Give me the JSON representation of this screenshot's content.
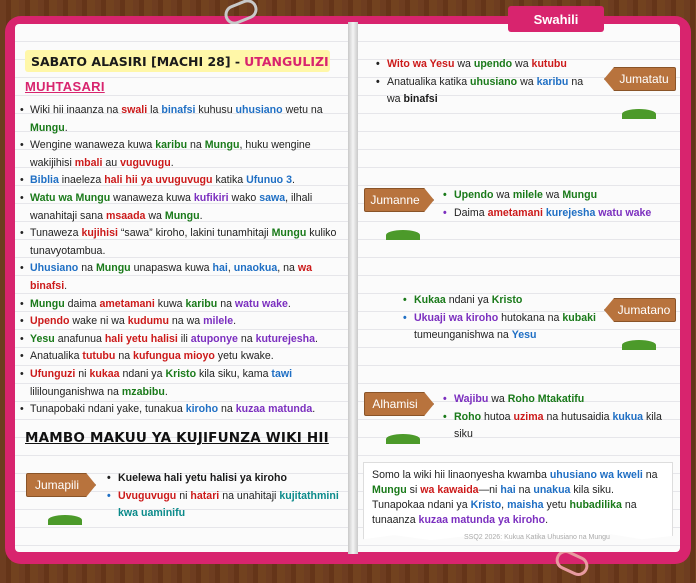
{
  "language_tab": "Swahili",
  "lesson": {
    "title": "SABATO ALASIRI [MACHI 28] -",
    "title_highlight": "UTANGULIZI"
  },
  "summary_heading": "MUHTASARI",
  "summary_points": [
    [
      [
        "Wiki hii inaanza na ",
        ""
      ],
      [
        "swali",
        "r"
      ],
      [
        " la ",
        ""
      ],
      [
        "binafsi",
        "b"
      ],
      [
        " kuhusu ",
        ""
      ],
      [
        "uhusiano",
        "b"
      ],
      [
        " wetu na ",
        ""
      ],
      [
        "Mungu",
        "g"
      ],
      [
        ".",
        ""
      ]
    ],
    [
      [
        "Wengine wanaweza kuwa ",
        ""
      ],
      [
        "karibu",
        "g"
      ],
      [
        " na ",
        ""
      ],
      [
        "Mungu",
        "g"
      ],
      [
        ", huku wengine wakijihisi ",
        ""
      ],
      [
        "mbali",
        "r"
      ],
      [
        " au ",
        ""
      ],
      [
        "vuguvugu",
        "r"
      ],
      [
        ".",
        ""
      ]
    ],
    [
      [
        "Biblia",
        "b"
      ],
      [
        " inaeleza ",
        ""
      ],
      [
        "hali hii ya uvuguvugu",
        "r"
      ],
      [
        " katika ",
        ""
      ],
      [
        "Ufunuo 3",
        "b"
      ],
      [
        ".",
        ""
      ]
    ],
    [
      [
        "Watu wa Mungu",
        "g"
      ],
      [
        " wanaweza kuwa ",
        ""
      ],
      [
        "kufikiri",
        "p"
      ],
      [
        " wako ",
        ""
      ],
      [
        "sawa",
        "b"
      ],
      [
        ", ilhali wanahitaji sana ",
        ""
      ],
      [
        "msaada",
        "r"
      ],
      [
        " wa ",
        ""
      ],
      [
        "Mungu",
        "g"
      ],
      [
        ".",
        ""
      ]
    ],
    [
      [
        "Tunaweza ",
        ""
      ],
      [
        "kujihisi",
        "r"
      ],
      [
        " “sawa” kiroho, lakini tunamhitaji ",
        ""
      ],
      [
        "Mungu",
        "g"
      ],
      [
        " kuliko tunavyotambua.",
        ""
      ]
    ],
    [
      [
        "Uhusiano",
        "b"
      ],
      [
        " na ",
        ""
      ],
      [
        "Mungu",
        "g"
      ],
      [
        " unapaswa kuwa ",
        ""
      ],
      [
        "hai",
        "b"
      ],
      [
        ", ",
        ""
      ],
      [
        "unaokua",
        "b"
      ],
      [
        ", na ",
        ""
      ],
      [
        "wa binafsi",
        "r"
      ],
      [
        ".",
        ""
      ]
    ],
    [
      [
        "Mungu",
        "g"
      ],
      [
        " daima ",
        ""
      ],
      [
        "ametamani",
        "r"
      ],
      [
        " kuwa ",
        ""
      ],
      [
        "karibu",
        "g"
      ],
      [
        " na ",
        ""
      ],
      [
        "watu wake",
        "p"
      ],
      [
        ".",
        ""
      ]
    ],
    [
      [
        "Upendo",
        "r"
      ],
      [
        " wake ni wa ",
        ""
      ],
      [
        "kudumu",
        "r"
      ],
      [
        " na wa ",
        ""
      ],
      [
        "milele",
        "p"
      ],
      [
        ".",
        ""
      ]
    ],
    [
      [
        "Yesu",
        "g"
      ],
      [
        " anafunua ",
        ""
      ],
      [
        "hali yetu halisi",
        "r"
      ],
      [
        " ili ",
        ""
      ],
      [
        "atuponye",
        "p"
      ],
      [
        " na ",
        ""
      ],
      [
        "kuturejesha",
        "p"
      ],
      [
        ".",
        ""
      ]
    ],
    [
      [
        "Anatualika ",
        ""
      ],
      [
        "tutubu",
        "r"
      ],
      [
        " na ",
        ""
      ],
      [
        "kufungua mioyo",
        "r"
      ],
      [
        " yetu kwake.",
        ""
      ]
    ],
    [
      [
        "Ufunguzi",
        "r"
      ],
      [
        " ni ",
        ""
      ],
      [
        "kukaa",
        "r"
      ],
      [
        " ndani ya ",
        ""
      ],
      [
        "Kristo",
        "g"
      ],
      [
        " kila siku, kama ",
        ""
      ],
      [
        "tawi",
        "b"
      ],
      [
        " lililounganishwa na ",
        ""
      ],
      [
        "mzabibu",
        "g"
      ],
      [
        ".",
        ""
      ]
    ],
    [
      [
        "Tunapobaki ndani yake, tunakua ",
        ""
      ],
      [
        "kiroho",
        "b"
      ],
      [
        " na ",
        ""
      ],
      [
        "kuzaa matunda",
        "p"
      ],
      [
        ".",
        ""
      ]
    ]
  ],
  "key_heading": "MAMBO MAKUU YA KUJIFUNZA WIKI HII",
  "days": [
    {
      "label": "Jumapili",
      "items": [
        {
          "bullet": "c4",
          "parts": [
            [
              "Kuelewa hali yetu halisi ya kiroho",
              "d"
            ]
          ]
        },
        {
          "bullet": "c2",
          "parts": [
            [
              "Uvuguvugu",
              "r"
            ],
            [
              " ni ",
              ""
            ],
            [
              "hatari",
              "r"
            ],
            [
              " na unahitaji ",
              ""
            ],
            [
              "kujitathmini kwa uaminifu",
              "t"
            ]
          ]
        }
      ]
    },
    {
      "label": "Jumatatu",
      "items": [
        {
          "bullet": "c4",
          "parts": [
            [
              "Wito wa Yesu",
              "r"
            ],
            [
              " wa ",
              ""
            ],
            [
              "upendo",
              "g"
            ],
            [
              " wa ",
              ""
            ],
            [
              "kutubu",
              "r"
            ]
          ]
        },
        {
          "bullet": "c4",
          "parts": [
            [
              "Anatualika katika ",
              ""
            ],
            [
              "uhusiano",
              "g"
            ],
            [
              " wa ",
              ""
            ],
            [
              "karibu",
              "b"
            ],
            [
              " na wa ",
              ""
            ],
            [
              "binafsi",
              "d"
            ]
          ]
        }
      ]
    },
    {
      "label": "Jumanne",
      "items": [
        {
          "bullet": "c1",
          "parts": [
            [
              "Upendo",
              "g"
            ],
            [
              " wa ",
              ""
            ],
            [
              "milele",
              "g"
            ],
            [
              " wa ",
              ""
            ],
            [
              "Mungu",
              "g"
            ]
          ]
        },
        {
          "bullet": "c3",
          "parts": [
            [
              "Daima ",
              ""
            ],
            [
              "ametamani",
              "r"
            ],
            [
              " ",
              ""
            ],
            [
              "kurejesha",
              "b"
            ],
            [
              " ",
              ""
            ],
            [
              "watu wake",
              "p"
            ]
          ]
        }
      ]
    },
    {
      "label": "Jumatano",
      "items": [
        {
          "bullet": "c1",
          "parts": [
            [
              "Kukaa",
              "g"
            ],
            [
              " ndani ya ",
              ""
            ],
            [
              "Kristo",
              "g"
            ]
          ]
        },
        {
          "bullet": "c2",
          "parts": [
            [
              "Ukuaji wa kiroho",
              "p"
            ],
            [
              " hutokana na ",
              ""
            ],
            [
              "kubaki",
              "g"
            ],
            [
              " tumeunganishwa na ",
              ""
            ],
            [
              "Yesu",
              "b"
            ]
          ]
        }
      ]
    },
    {
      "label": "Alhamisi",
      "items": [
        {
          "bullet": "c3",
          "parts": [
            [
              "Wajibu",
              "p"
            ],
            [
              " wa ",
              ""
            ],
            [
              "Roho Mtakatifu",
              "g"
            ]
          ]
        },
        {
          "bullet": "c1",
          "parts": [
            [
              "Roho",
              "g"
            ],
            [
              " hutoa ",
              ""
            ],
            [
              "uzima",
              "r"
            ],
            [
              " na hutusaidia ",
              ""
            ],
            [
              "kukua",
              "b"
            ],
            [
              " kila siku",
              ""
            ]
          ]
        }
      ]
    }
  ],
  "closing_summary": [
    [
      "Somo la wiki hii linaonyesha kwamba ",
      ""
    ],
    [
      "uhusiano wa kweli",
      "b"
    ],
    [
      " na ",
      ""
    ],
    [
      "Mungu",
      "g"
    ],
    [
      " si ",
      ""
    ],
    [
      "wa kawaida",
      "r"
    ],
    [
      "—ni ",
      ""
    ],
    [
      "hai",
      "b"
    ],
    [
      " na ",
      ""
    ],
    [
      "unakua",
      "b"
    ],
    [
      " kila siku. Tunapokaa ndani ya ",
      ""
    ],
    [
      "Kristo",
      "b"
    ],
    [
      ", ",
      ""
    ],
    [
      "maisha",
      "b"
    ],
    [
      " yetu ",
      ""
    ],
    [
      "hubadilika",
      "g"
    ],
    [
      " na tunaanza ",
      ""
    ],
    [
      "kuzaa matunda ya kiroho",
      "p"
    ],
    [
      ".",
      ""
    ]
  ],
  "footer": "SSQ2 2026: Kukua Katika Uhusiano na Mungu",
  "colors": {
    "cover": "#d8246e",
    "highlight_green": "#1a7a1a",
    "highlight_blue": "#1f6fc4",
    "highlight_red": "#cc1a1a",
    "highlight_purple": "#7b2fbf"
  },
  "icons": [
    "paperclip-icon",
    "signpost-icon"
  ]
}
